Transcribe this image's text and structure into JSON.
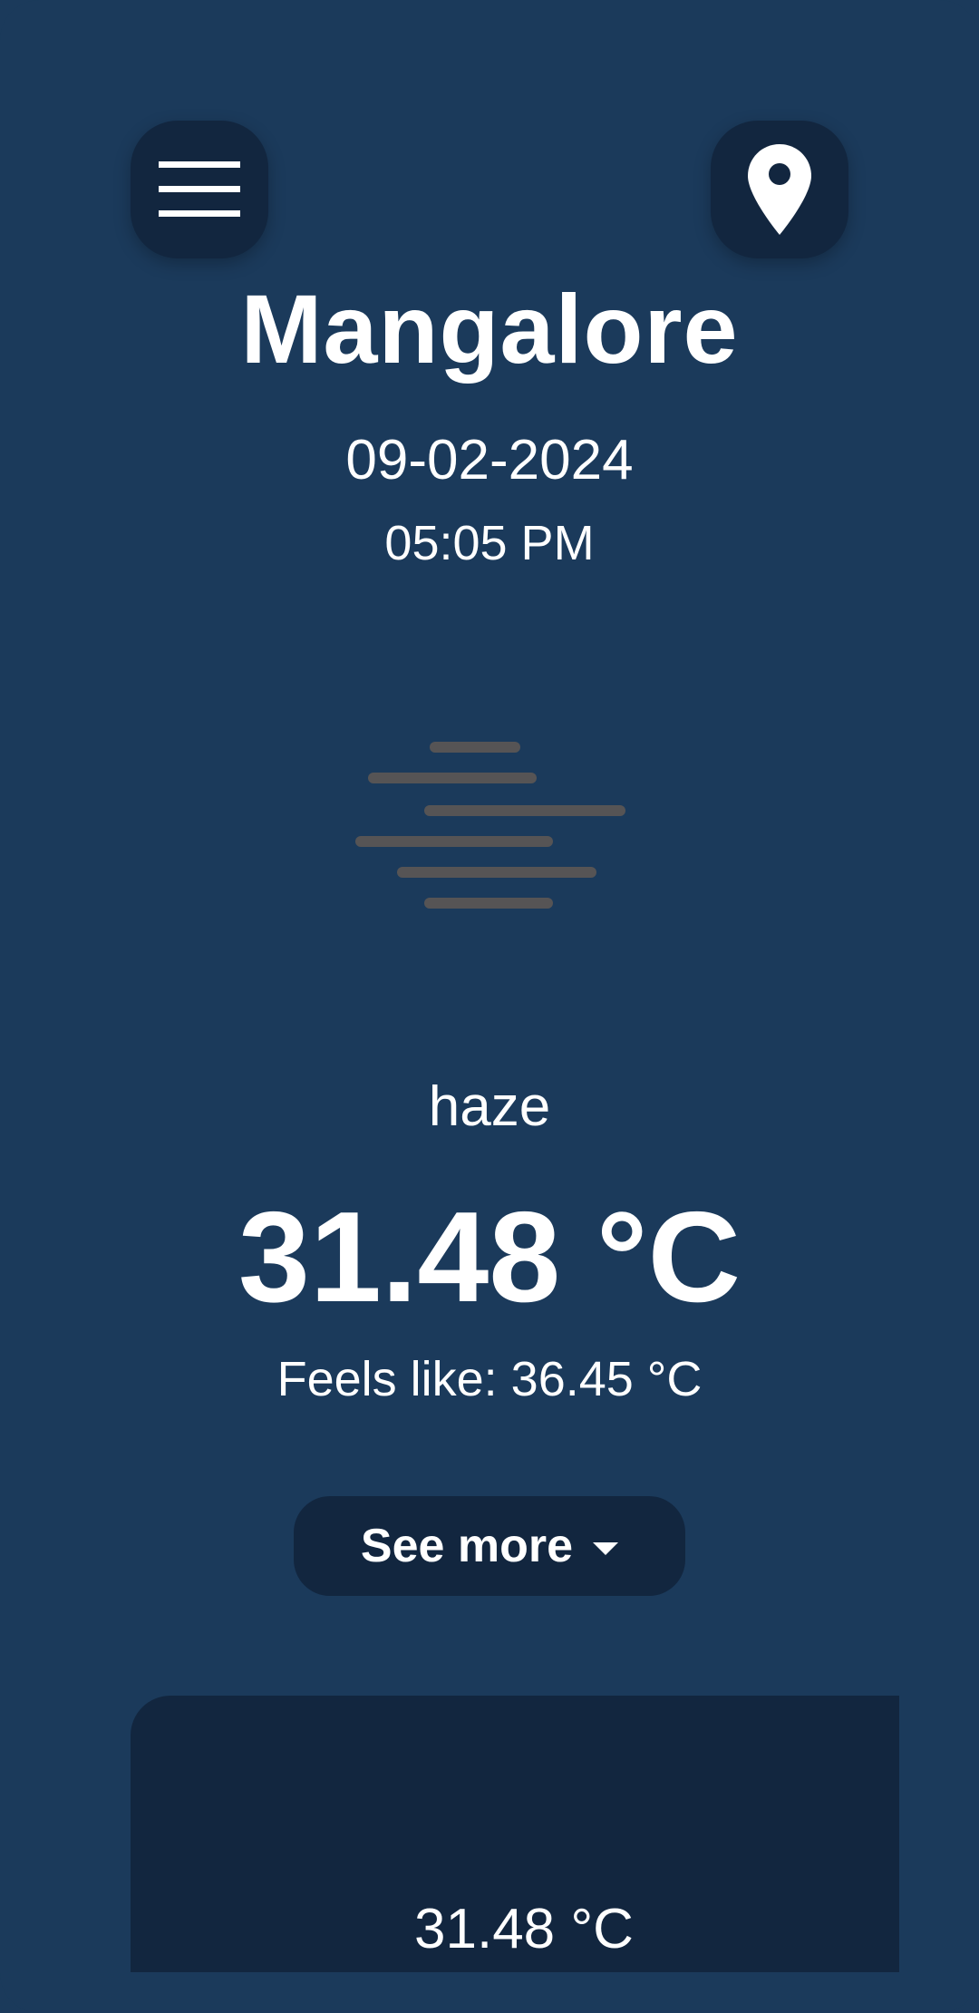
{
  "header": {
    "menu_icon": "hamburger-menu-icon",
    "location_icon": "map-pin-icon"
  },
  "location": {
    "city": "Mangalore",
    "date": "09-02-2024",
    "time": "05:05 PM"
  },
  "weather": {
    "icon": "haze-icon",
    "condition": "haze",
    "temperature": "31.48 °C",
    "feels_like": "Feels like: 36.45 °C"
  },
  "actions": {
    "see_more_label": "See more"
  },
  "card": {
    "temperature": "31.48 °C"
  },
  "colors": {
    "background": "#1b3a5b",
    "surface": "#12263f",
    "text": "#ffffff",
    "haze_lines": "#5a5655"
  }
}
